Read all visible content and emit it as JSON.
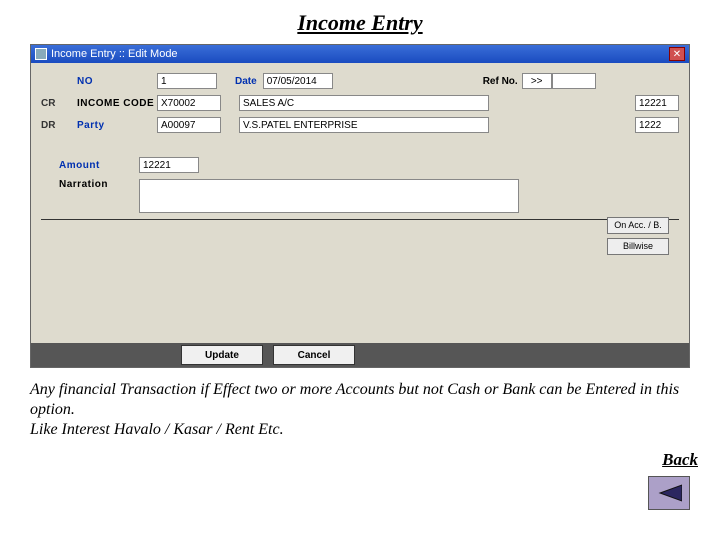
{
  "page": {
    "title": "Income Entry"
  },
  "window": {
    "title": "Income Entry :: Edit Mode"
  },
  "labels": {
    "no": "NO",
    "date": "Date",
    "refno": "Ref No.",
    "cr": "CR",
    "incomeCode": "INCOME CODE",
    "dr": "DR",
    "party": "Party",
    "amount": "Amount",
    "narration": "Narration"
  },
  "values": {
    "no": "1",
    "date": "07/05/2014",
    "refBtn": ">>",
    "refno": "",
    "incomeCode": "X70002",
    "incomeDesc": "SALES A/C",
    "incomeRef": "12221",
    "partyCode": "A00097",
    "partyDesc": "V.S.PATEL ENTERPRISE",
    "partyRef": "1222",
    "amount": "12221",
    "narration": ""
  },
  "buttons": {
    "onAcc": "On Acc. / B.",
    "billwise": "Billwise",
    "update": "Update",
    "cancel": "Cancel"
  },
  "footer": {
    "desc": "Any financial Transaction if Effect two or more Accounts but not Cash or Bank can be Entered in this option.\nLike Interest Havalo / Kasar / Rent Etc.",
    "back": "Back"
  }
}
